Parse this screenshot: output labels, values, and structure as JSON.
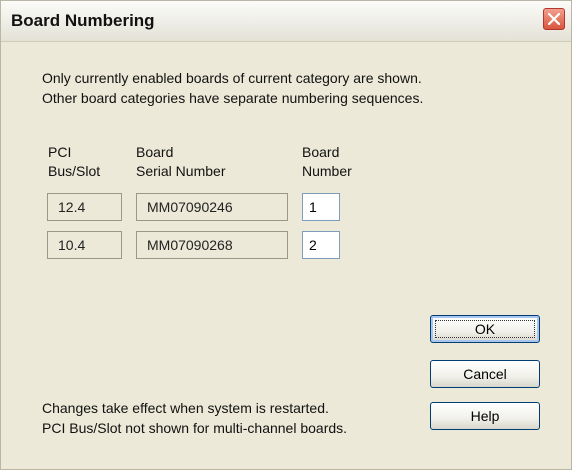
{
  "dialog": {
    "title": "Board Numbering",
    "close_icon": "close-icon",
    "intro_line1": "Only currently enabled boards of current category are shown.",
    "intro_line2": "Other board categories have separate numbering sequences."
  },
  "columns": {
    "pci_line1": "PCI",
    "pci_line2": "Bus/Slot",
    "serial_line1": "Board",
    "serial_line2": "Serial Number",
    "number_line1": "Board",
    "number_line2": "Number"
  },
  "boards": [
    {
      "pci": "12.4",
      "serial": "MM07090246",
      "number": "1"
    },
    {
      "pci": "10.4",
      "serial": "MM07090268",
      "number": "2"
    }
  ],
  "buttons": {
    "ok": "OK",
    "cancel": "Cancel",
    "help": "Help"
  },
  "footer": {
    "line1": "Changes take effect when system is restarted.",
    "line2": "PCI Bus/Slot not shown for multi-channel boards."
  },
  "colors": {
    "dialog_bg": "#ece9d8",
    "close_button": "#d9553e",
    "button_border": "#003c74"
  }
}
